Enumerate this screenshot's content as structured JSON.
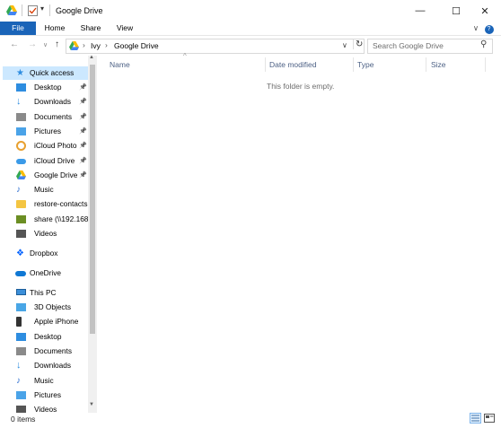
{
  "window": {
    "title": "Google Drive",
    "buttons": {
      "minimize": "—",
      "maximize": "☐",
      "close": "✕"
    }
  },
  "ribbon": {
    "tabs": [
      "File",
      "Home",
      "Share",
      "View"
    ],
    "collapse_glyph": "∨",
    "help_glyph": "?"
  },
  "nav": {
    "back": "←",
    "forward": "→",
    "recent": "∨",
    "up": "↑",
    "breadcrumb": [
      "Ivy",
      "Google Drive"
    ],
    "separator": "›",
    "dropdown": "∨",
    "refresh": "↻",
    "search_placeholder": "Search Google Drive",
    "search_icon": "⚲"
  },
  "sidebar": {
    "quick_access_label": "Quick access",
    "quick_items": [
      {
        "label": "Desktop",
        "icon": "desktop-icon",
        "color": "#2e8de0",
        "pinned": true
      },
      {
        "label": "Downloads",
        "icon": "downloads-icon",
        "color": "#2e8de0",
        "pinned": true
      },
      {
        "label": "Documents",
        "icon": "documents-icon",
        "color": "#8a8a8a",
        "pinned": true
      },
      {
        "label": "Pictures",
        "icon": "pictures-icon",
        "color": "#4aa3e8",
        "pinned": true
      },
      {
        "label": "iCloud Photo",
        "icon": "icloud-photos-icon",
        "color": "#e8a030",
        "pinned": true
      },
      {
        "label": "iCloud Drive",
        "icon": "icloud-drive-icon",
        "color": "#3a9ae8",
        "pinned": true
      },
      {
        "label": "Google Drive",
        "icon": "google-drive-icon",
        "color": "#34a853",
        "pinned": true
      },
      {
        "label": "Music",
        "icon": "music-icon",
        "color": "#2e6fd0",
        "pinned": false
      },
      {
        "label": "restore-contacts",
        "icon": "folder-icon",
        "color": "#f4c542",
        "pinned": false
      },
      {
        "label": "share (\\\\192.168.",
        "icon": "network-drive-icon",
        "color": "#6b8e23",
        "pinned": false
      },
      {
        "label": "Videos",
        "icon": "videos-icon",
        "color": "#555555",
        "pinned": false
      }
    ],
    "dropbox_label": "Dropbox",
    "onedrive_label": "OneDrive",
    "this_pc_label": "This PC",
    "pc_items": [
      {
        "label": "3D Objects",
        "icon": "3d-objects-icon",
        "color": "#49a6e6"
      },
      {
        "label": "Apple iPhone",
        "icon": "iphone-icon",
        "color": "#333333"
      },
      {
        "label": "Desktop",
        "icon": "desktop-icon",
        "color": "#2e8de0"
      },
      {
        "label": "Documents",
        "icon": "documents-icon",
        "color": "#8a8a8a"
      },
      {
        "label": "Downloads",
        "icon": "downloads-icon",
        "color": "#2e8de0"
      },
      {
        "label": "Music",
        "icon": "music-icon",
        "color": "#2e6fd0"
      },
      {
        "label": "Pictures",
        "icon": "pictures-icon",
        "color": "#4aa3e8"
      },
      {
        "label": "Videos",
        "icon": "videos-icon",
        "color": "#555555"
      }
    ],
    "scroll_up": "▲",
    "scroll_down": "▼"
  },
  "content": {
    "columns": [
      "Name",
      "Date modified",
      "Type",
      "Size"
    ],
    "sort_glyph": "^",
    "empty_message": "This folder is empty."
  },
  "status": {
    "items": "0 items"
  },
  "colors": {
    "accent": "#1a64b8",
    "selected": "#cce8ff",
    "header_text": "#4d6185"
  }
}
